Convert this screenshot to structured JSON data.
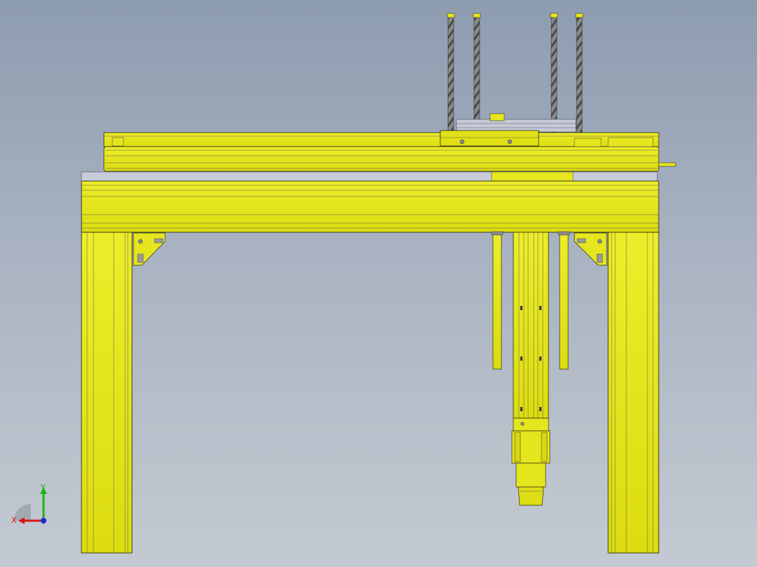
{
  "viewport": {
    "background_top": "#8e9cb0",
    "background_bottom": "#c4cad2"
  },
  "model": {
    "part_color": "#e6e61e",
    "part_shade": "#c9c90e",
    "edge_color": "#2b2b10",
    "rod_color": "#6e6e6e"
  },
  "triad": {
    "x_label": "X",
    "y_label": "Y",
    "x_color": "#d21a1a",
    "y_color": "#1db31d",
    "z_color": "#1a2ad2"
  }
}
